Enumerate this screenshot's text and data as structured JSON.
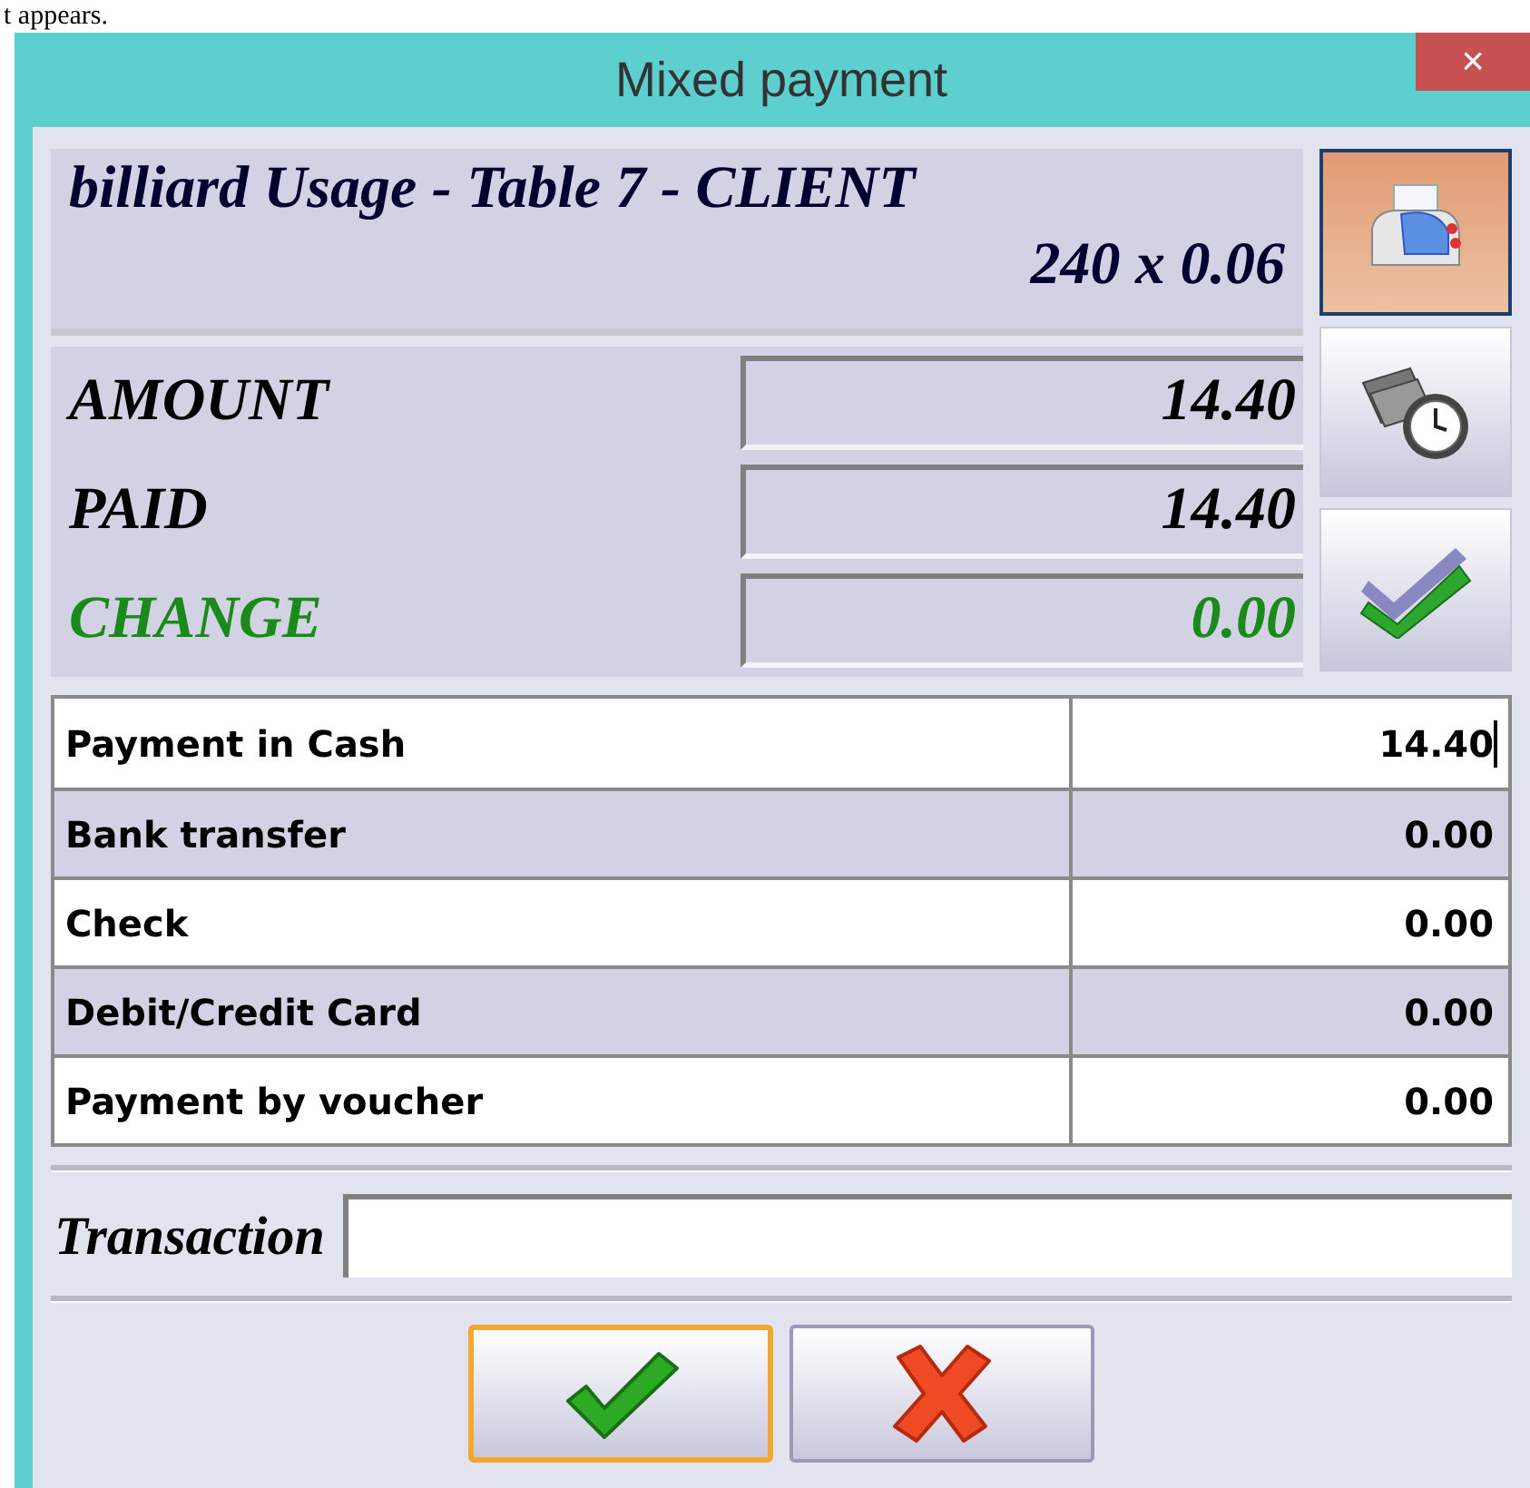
{
  "caption": "t appears.",
  "window": {
    "title": "Mixed payment",
    "close": "×"
  },
  "header": {
    "title": "billiard Usage - Table 7 - CLIENT",
    "detail": "240 x 0.06"
  },
  "summary": [
    {
      "kind": "normal",
      "label": "AMOUNT",
      "value": "14.40"
    },
    {
      "kind": "normal",
      "label": "PAID",
      "value": "14.40"
    },
    {
      "kind": "change",
      "label": "CHANGE",
      "value": "0.00"
    }
  ],
  "tools": [
    {
      "kind": "print",
      "selected": true
    },
    {
      "kind": "timer",
      "selected": false
    },
    {
      "kind": "validate",
      "selected": false
    }
  ],
  "payments": [
    {
      "method": "Payment in Cash",
      "amount": "14.40",
      "focused": true
    },
    {
      "method": "Bank transfer",
      "amount": "0.00",
      "focused": false
    },
    {
      "method": "Check",
      "amount": "0.00",
      "focused": false
    },
    {
      "method": "Debit/Credit Card",
      "amount": "0.00",
      "focused": false
    },
    {
      "method": "Payment by voucher",
      "amount": "0.00",
      "focused": false
    }
  ],
  "transaction": {
    "label": "Transaction"
  },
  "buttons": [
    {
      "kind": "ok",
      "focused": true
    },
    {
      "kind": "cancel",
      "focused": false
    }
  ]
}
